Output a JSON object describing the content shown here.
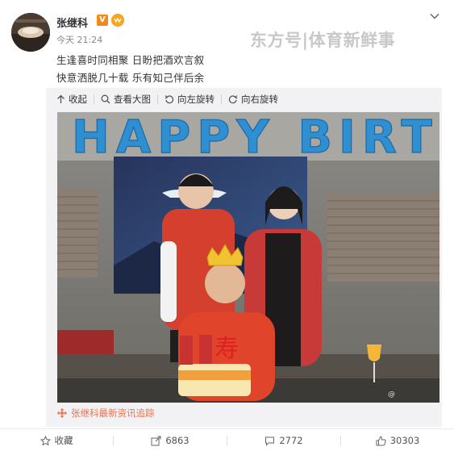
{
  "post": {
    "author": "张继科",
    "verified_badge": "V",
    "time": "今天 21:24",
    "text_line1": "生逢喜时同相聚 日盼把酒欢言叙",
    "text_line2": "快意洒脱几十载 乐有知己伴后余",
    "watermark": "东方号|体育新鲜事"
  },
  "image_toolbar": {
    "collapse": "收起",
    "view_large": "查看大图",
    "rotate_left": "向左旋转",
    "rotate_right": "向右旋转"
  },
  "photo": {
    "balloon_text": "HAPPY BIRT",
    "cake_text": "寿"
  },
  "source": "张继科最新资讯追踪",
  "actions": {
    "favorite": "收藏",
    "share_count": "6863",
    "comment_count": "2772",
    "like_count": "30303"
  },
  "colors": {
    "accent": "#eb7350",
    "verified": "#f08a18",
    "balloon": "#2f8fd0"
  }
}
